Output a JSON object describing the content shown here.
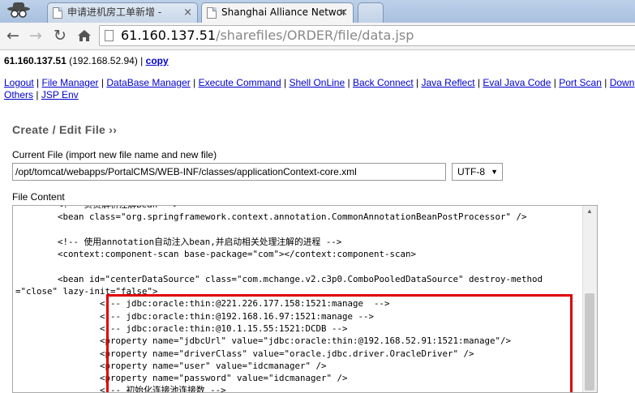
{
  "browser": {
    "tabs": [
      {
        "title": "申请进机房工单新增 -"
      },
      {
        "title": "Shanghai Alliance Networ"
      }
    ],
    "close_glyph": "×",
    "address": {
      "host": "61.160.137.51",
      "path": "/sharefiles/ORDER/file/data.jsp"
    },
    "icons": [
      "spy-icon",
      "back-icon",
      "forward-icon",
      "reload-icon",
      "home-icon",
      "page-icon"
    ]
  },
  "page": {
    "host_ip": "61.160.137.51",
    "host_local": "(192.168.52.94)",
    "separator": "|",
    "copy_link": "copy",
    "menu": [
      "Logout",
      "File Manager",
      "DataBase Manager",
      "Execute Command",
      "Shell OnLine",
      "Back Connect",
      "Java Reflect",
      "Eval Java Code",
      "Port Scan",
      "Down",
      "Others",
      "JSP Env"
    ],
    "section_title": "Create / Edit File ››",
    "current_file_label": "Current File (import new file name and new file)",
    "current_file_value": "/opt/tomcat/webapps/PortalCMS/WEB-INF/classes/applicationContext-core.xml",
    "encoding": "UTF-8",
    "file_content_label": "File Content",
    "file_content": "        <!-- 负责解析注解Bean -->\n        <bean class=\"org.springframework.context.annotation.CommonAnnotationBeanPostProcessor\" />\n\n        <!-- 使用annotation自动注入bean,并启动相关处理注解的进程 -->\n        <context:component-scan base-package=\"com\"></context:component-scan>\n\n        <bean id=\"centerDataSource\" class=\"com.mchange.v2.c3p0.ComboPooledDataSource\" destroy-method\n=\"close\" lazy-init=\"false\">\n                <!-- jdbc:oracle:thin:@221.226.177.158:1521:manage  -->\n                <!-- jdbc:oracle:thin:@192.168.16.97:1521:manage -->\n                <!-- jdbc:oracle:thin:@10.1.15.55:1521:DCDB -->\n                <property name=\"jdbcUrl\" value=\"jdbc:oracle:thin:@192.168.52.91:1521:manage\"/>\n                <property name=\"driverClass\" value=\"oracle.jdbc.driver.OracleDriver\" />\n                <property name=\"user\" value=\"idcmanager\" />\n                <property name=\"password\" value=\"idcmanager\" />\n                <!-- 初始化连接池连接数 -->"
  },
  "colors": {
    "link": "#0000cc",
    "highlight_box": "#e00000",
    "section_title": "#555555"
  }
}
